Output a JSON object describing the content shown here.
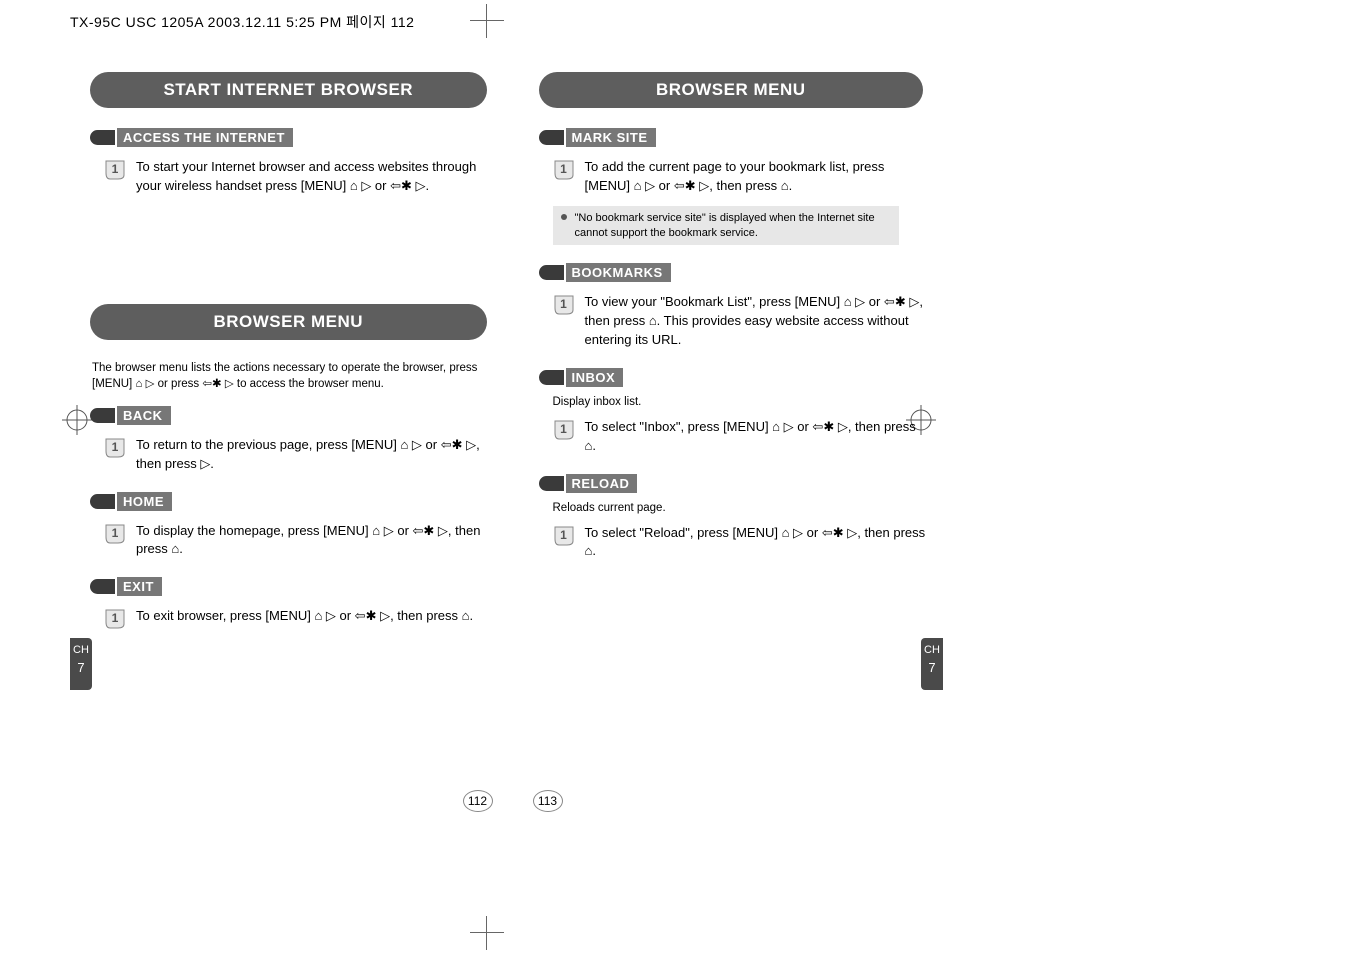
{
  "print_header": "TX-95C USC 1205A  2003.12.11 5:25 PM  페이지 112",
  "left": {
    "title1": "START INTERNET BROWSER",
    "access": {
      "label": "ACCESS THE INTERNET",
      "step1": "To start your Internet browser and access websites through your wireless handset press [MENU] ⌂ ▷ or ⇦✱ ▷."
    },
    "title2": "BROWSER MENU",
    "intro": "The browser menu lists the actions necessary to operate the browser, press [MENU] ⌂ ▷ or press ⇦✱ ▷ to access the browser menu.",
    "back": {
      "label": "BACK",
      "step1": "To return to the previous page, press [MENU] ⌂ ▷ or ⇦✱ ▷, then press ▷."
    },
    "home": {
      "label": "HOME",
      "step1": "To display the homepage, press [MENU] ⌂ ▷ or ⇦✱ ▷, then press ⌂."
    },
    "exit": {
      "label": "EXIT",
      "step1": "To exit browser, press [MENU] ⌂ ▷ or ⇦✱ ▷, then press ⌂."
    },
    "ch_label": "CH",
    "ch_num": "7",
    "page_num": "112"
  },
  "right": {
    "title": "BROWSER MENU",
    "mark": {
      "label": "MARK SITE",
      "step1": "To add the current page to your bookmark list, press [MENU] ⌂ ▷ or ⇦✱ ▷, then press ⌂.",
      "note": "\"No bookmark service site\" is displayed when the Internet site cannot support the bookmark service."
    },
    "bookmarks": {
      "label": "BOOKMARKS",
      "step1": "To view your \"Bookmark List\", press [MENU] ⌂ ▷ or ⇦✱ ▷, then press ⌂. This provides easy website access without entering its URL."
    },
    "inbox": {
      "label": "INBOX",
      "sub": "Display inbox list.",
      "step1": "To select \"Inbox\", press [MENU] ⌂ ▷ or ⇦✱ ▷, then press ⌂."
    },
    "reload": {
      "label": "RELOAD",
      "sub": "Reloads current page.",
      "step1": "To select \"Reload\", press [MENU] ⌂ ▷ or ⇦✱ ▷, then press ⌂."
    },
    "ch_label": "CH",
    "ch_num": "7",
    "page_num": "113"
  }
}
